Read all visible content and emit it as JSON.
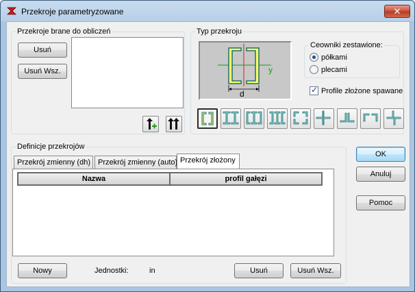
{
  "window": {
    "title": "Przekroje parametryzowane",
    "close_label": "✕"
  },
  "sections_group": {
    "legend": "Przekroje brane do obliczeń",
    "remove_label": "Usuń",
    "remove_all_label": "Usuń Wsz."
  },
  "type_group": {
    "legend": "Typ przekroju",
    "axis_y": "y",
    "dim_d": "d",
    "channels_legend": "Ceowniki zestawione:",
    "option_flanges": "półkami",
    "option_backs": "plecami",
    "welded_label": "Profile złożone spawane"
  },
  "definitions_group": {
    "legend": "Definicje przekrojów",
    "tabs": [
      {
        "label": "Przekrój zmienny (dh)"
      },
      {
        "label": "Przekrój zmienny (auto)"
      },
      {
        "label": "Przekrój złożony"
      }
    ],
    "columns": [
      "Nazwa",
      "profil gałęzi"
    ]
  },
  "bottom": {
    "new_label": "Nowy",
    "units_label": "Jednostki:",
    "units_value": "in",
    "remove_label": "Usuń",
    "remove_all_label": "Usuń Wsz."
  },
  "side_buttons": {
    "ok": "OK",
    "cancel": "Anuluj",
    "help": "Pomoc"
  },
  "colors": {
    "accent": "#3c7fb1",
    "section_fill": "#ffff66",
    "section_stroke": "#2a8a8a"
  }
}
